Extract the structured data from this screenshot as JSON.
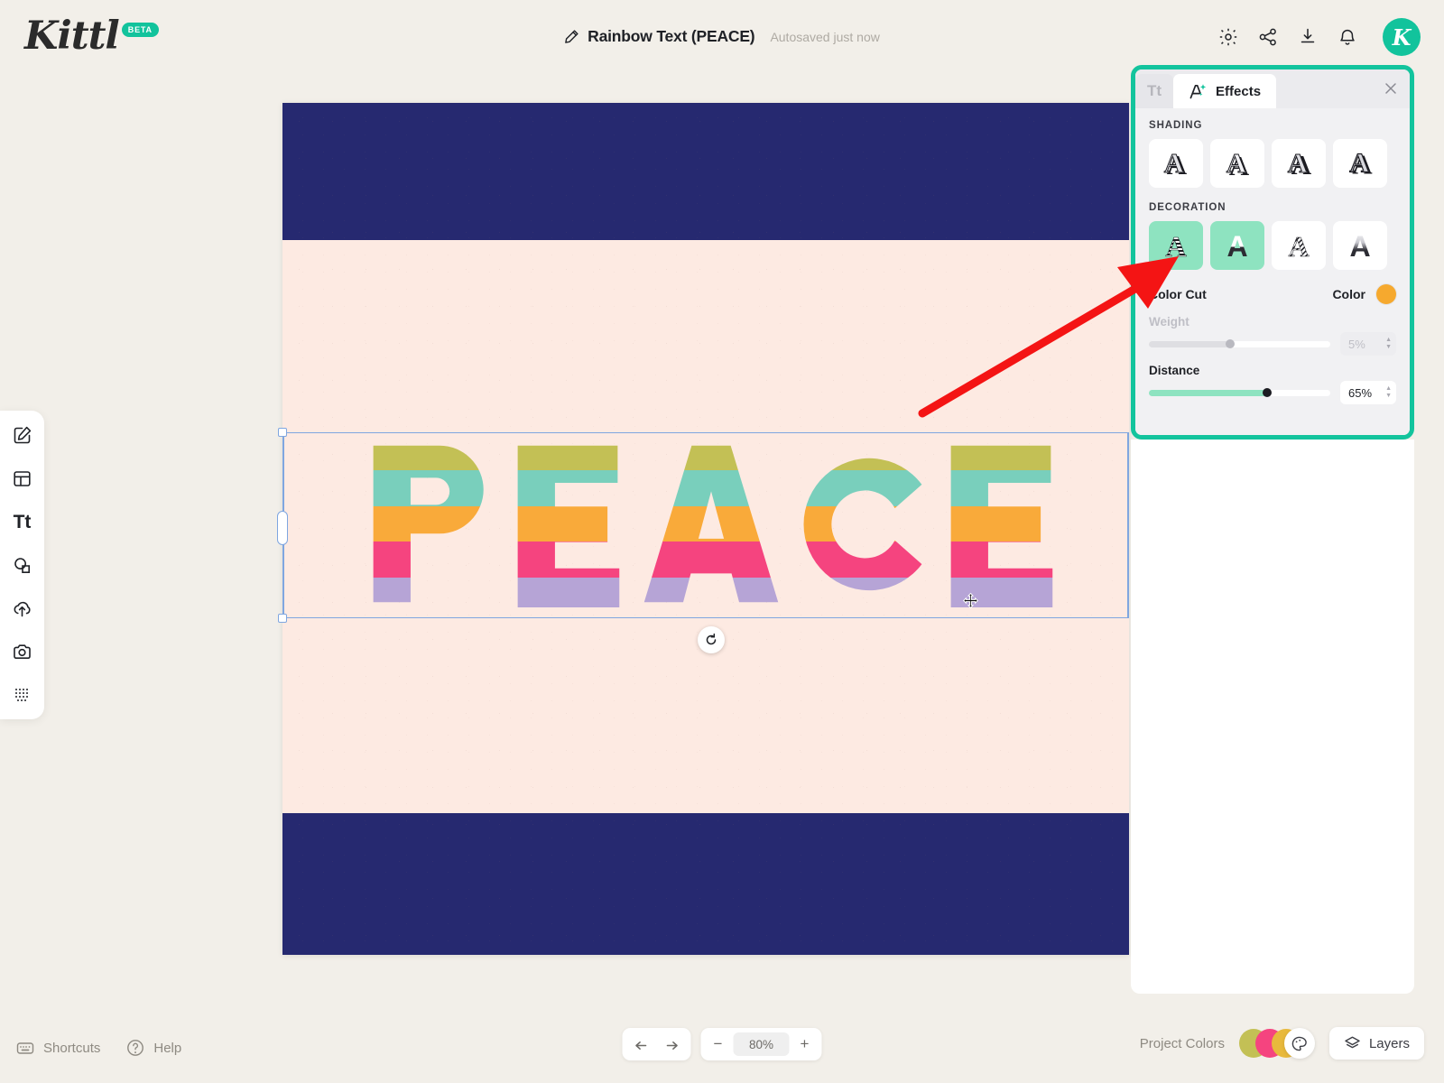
{
  "app": {
    "logo_text": "Kittl",
    "logo_badge": "BETA",
    "brand_teal": "#12C39C"
  },
  "header": {
    "pencil_icon": "pencil-icon",
    "doc_title": "Rainbow Text (PEACE)",
    "autosave_status": "Autosaved just now",
    "actions": [
      {
        "name": "settings-icon",
        "icon": "gear-icon"
      },
      {
        "name": "share-icon",
        "icon": "share-icon"
      },
      {
        "name": "download-icon",
        "icon": "download-icon"
      },
      {
        "name": "notifications-icon",
        "icon": "bell-icon"
      }
    ],
    "avatar_initial": "K"
  },
  "left_toolbar": {
    "items": [
      {
        "name": "tool-design",
        "icon": "pencil-square-icon"
      },
      {
        "name": "tool-templates",
        "icon": "layout-icon"
      },
      {
        "name": "tool-text",
        "icon": "text-tt-icon",
        "label": "Tt"
      },
      {
        "name": "tool-elements",
        "icon": "shapes-icon"
      },
      {
        "name": "tool-uploads",
        "icon": "upload-cloud-icon"
      },
      {
        "name": "tool-photos",
        "icon": "camera-icon"
      },
      {
        "name": "tool-mockups",
        "icon": "dot-grid-icon"
      }
    ]
  },
  "canvas": {
    "word": "PEACE",
    "letters": [
      "P",
      "E",
      "A",
      "C",
      "E"
    ],
    "background_color": "#FDEAE2",
    "band_color": "#262970",
    "stripe_colors": [
      "#C3C055",
      "#79CFBC",
      "#F9AA3A",
      "#F5447F",
      "#B6A4D6"
    ],
    "rotate_handle_icon": "rotate-icon",
    "move_cursor_icon": "move-cursor-icon"
  },
  "effects_panel": {
    "tabs": [
      {
        "name": "tab-text",
        "label": "Tt",
        "active": false
      },
      {
        "name": "tab-effects",
        "label": "Effects",
        "active": true,
        "icon": "effects-sparkle-icon"
      }
    ],
    "close_icon": "close-icon",
    "shading": {
      "label": "SHADING",
      "tiles": [
        {
          "name": "shading-option-1",
          "selected": false
        },
        {
          "name": "shading-option-2",
          "selected": false
        },
        {
          "name": "shading-option-3",
          "selected": false
        },
        {
          "name": "shading-option-4",
          "selected": false
        }
      ]
    },
    "decoration": {
      "label": "DECORATION",
      "tiles": [
        {
          "name": "decoration-option-1",
          "selected": true
        },
        {
          "name": "decoration-option-2",
          "selected": true
        },
        {
          "name": "decoration-option-3",
          "selected": false
        },
        {
          "name": "decoration-option-4",
          "selected": false
        }
      ],
      "mode_label": "Color Cut",
      "color_label": "Color",
      "color_value": "#F6A92E",
      "sliders": [
        {
          "name": "weight-slider",
          "label": "Weight",
          "value": "5%",
          "fill_percent": 45,
          "enabled": false
        },
        {
          "name": "distance-slider",
          "label": "Distance",
          "value": "65%",
          "fill_percent": 65,
          "enabled": true
        }
      ]
    }
  },
  "bottom_bar": {
    "shortcuts_label": "Shortcuts",
    "help_label": "Help",
    "undo_icon": "undo-arrow-icon",
    "redo_icon": "redo-arrow-icon",
    "zoom_out_label": "−",
    "zoom_value": "80%",
    "zoom_in_label": "+",
    "project_colors_label": "Project Colors",
    "project_colors": [
      "#C3C055",
      "#F5447F",
      "#E8B93C"
    ],
    "palette_icon": "palette-icon",
    "layers_label": "Layers",
    "layers_icon": "layers-icon"
  }
}
